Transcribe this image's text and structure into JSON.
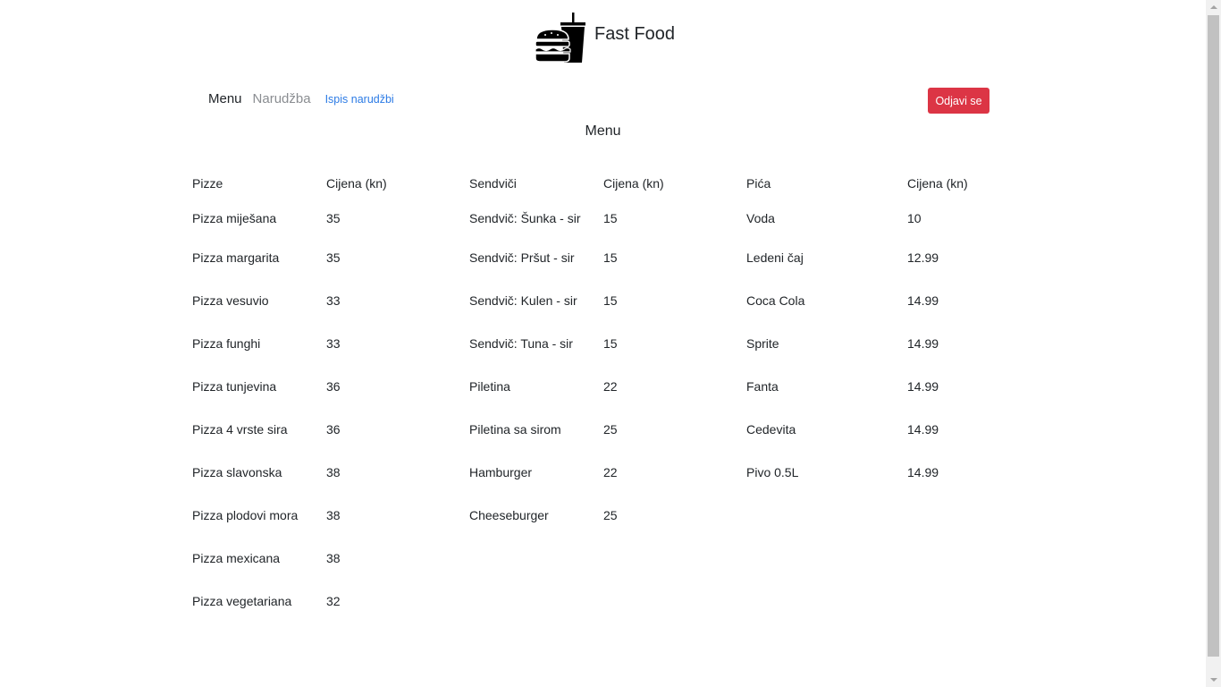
{
  "brand": {
    "name": "Fast Food",
    "logo_icon": "burger-drink-icon"
  },
  "nav": {
    "menu_label": "Menu",
    "order_label": "Narudžba",
    "orders_list_label": "Ispis narudžbi",
    "logout_label": "Odjavi se"
  },
  "colors": {
    "logout_button": "#dc3545",
    "link": "#2c7be5",
    "muted_nav": "#8a8d91"
  },
  "page": {
    "title": "Menu"
  },
  "tables": {
    "pizze": {
      "name_header": "Pizze",
      "price_header": "Cijena (kn)",
      "rows": [
        {
          "name": "Pizza miješana",
          "price": "35"
        },
        {
          "name": "Pizza margarita",
          "price": "35"
        },
        {
          "name": "Pizza vesuvio",
          "price": "33"
        },
        {
          "name": "Pizza funghi",
          "price": "33"
        },
        {
          "name": "Pizza tunjevina",
          "price": "36"
        },
        {
          "name": "Pizza 4 vrste sira",
          "price": "36"
        },
        {
          "name": "Pizza slavonska",
          "price": "38"
        },
        {
          "name": "Pizza plodovi mora",
          "price": "38"
        },
        {
          "name": "Pizza mexicana",
          "price": "38"
        },
        {
          "name": "Pizza vegetariana",
          "price": "32"
        }
      ]
    },
    "sendvici": {
      "name_header": "Sendviči",
      "price_header": "Cijena (kn)",
      "rows": [
        {
          "name": "Sendvič: Šunka - sir",
          "price": "15"
        },
        {
          "name": "Sendvič: Pršut - sir",
          "price": "15"
        },
        {
          "name": "Sendvič: Kulen - sir",
          "price": "15"
        },
        {
          "name": "Sendvič: Tuna - sir",
          "price": "15"
        },
        {
          "name": "Piletina",
          "price": "22"
        },
        {
          "name": "Piletina sa sirom",
          "price": "25"
        },
        {
          "name": "Hamburger",
          "price": "22"
        },
        {
          "name": "Cheeseburger",
          "price": "25"
        }
      ]
    },
    "pica": {
      "name_header": "Pića",
      "price_header": "Cijena (kn)",
      "rows": [
        {
          "name": "Voda",
          "price": "10"
        },
        {
          "name": "Ledeni čaj",
          "price": "12.99"
        },
        {
          "name": "Coca Cola",
          "price": "14.99"
        },
        {
          "name": "Sprite",
          "price": "14.99"
        },
        {
          "name": "Fanta",
          "price": "14.99"
        },
        {
          "name": "Cedevita",
          "price": "14.99"
        },
        {
          "name": "Pivo 0.5L",
          "price": "14.99"
        }
      ]
    }
  }
}
